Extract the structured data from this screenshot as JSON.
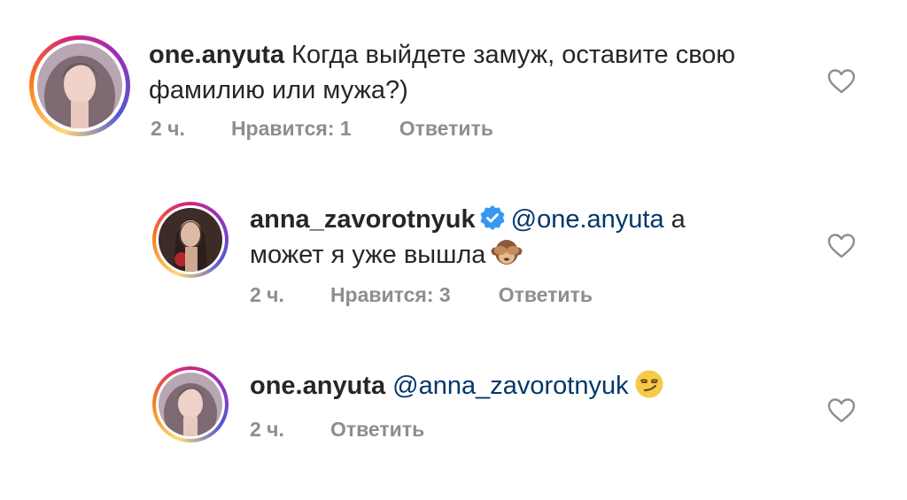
{
  "comments": [
    {
      "username": "one.anyuta",
      "text_line1": "Когда выйдете замуж, оставите свою",
      "text_line2": "фамилию или мужа?)",
      "time": "2 ч.",
      "likes": "Нравится: 1",
      "reply": "Ответить"
    },
    {
      "username": "anna_zavorotnyuk",
      "mention": "@one.anyuta",
      "text_after_mention": "а",
      "text_line2": "может я уже вышла",
      "emoji": "see-no-evil-monkey",
      "time": "2 ч.",
      "likes": "Нравится: 3",
      "reply": "Ответить"
    },
    {
      "username": "one.anyuta",
      "mention": "@anna_zavorotnyuk",
      "emoji": "smirking-face",
      "time": "2 ч.",
      "reply": "Ответить"
    }
  ],
  "colors": {
    "text": "#262626",
    "meta": "#8e8e8e",
    "mention": "#00376b",
    "verified": "#3897f0"
  }
}
